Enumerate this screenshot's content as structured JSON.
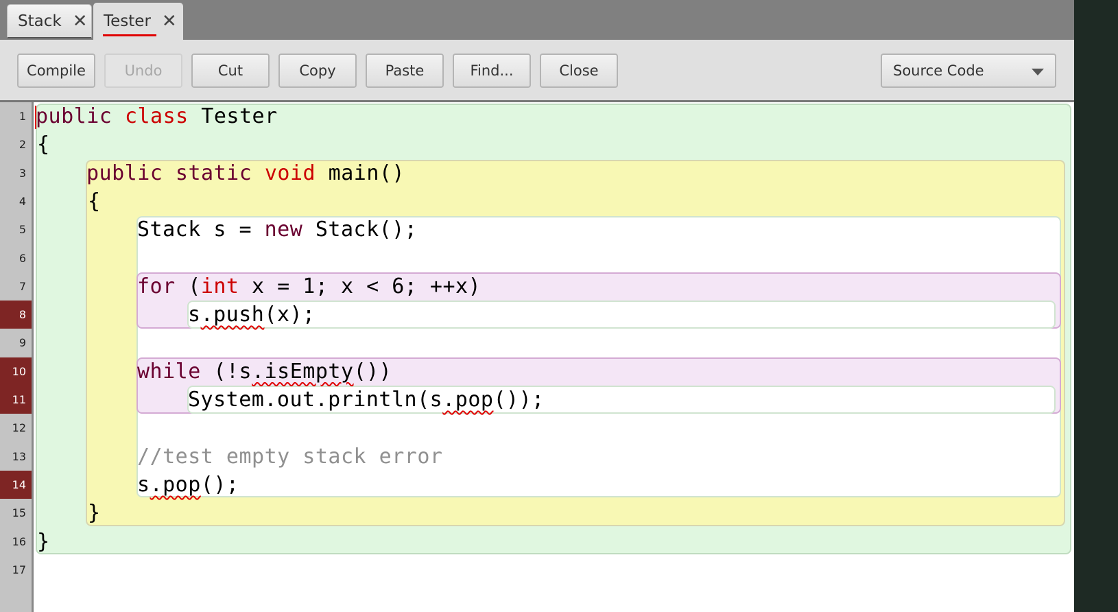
{
  "tabs": [
    {
      "label": "Stack",
      "active": false
    },
    {
      "label": "Tester",
      "active": true
    }
  ],
  "toolbar": {
    "compile": "Compile",
    "undo": "Undo",
    "cut": "Cut",
    "copy": "Copy",
    "paste": "Paste",
    "find": "Find...",
    "close": "Close",
    "view_select": "Source Code"
  },
  "colors": {
    "error_line": "#7e2524",
    "keyword": "#6a0030",
    "type_keyword": "#cc0000",
    "comment": "#909090",
    "class_scope": "#e0f7e0",
    "method_scope": "#f8f8b4",
    "loop_scope": "#f4e6f6"
  },
  "editor": {
    "line_numbers": [
      "1",
      "2",
      "3",
      "4",
      "5",
      "6",
      "7",
      "8",
      "9",
      "10",
      "11",
      "12",
      "13",
      "14",
      "15",
      "16",
      "17"
    ],
    "error_lines": [
      8,
      10,
      11,
      14
    ],
    "lines": {
      "l1": {
        "a": "public",
        "b": " ",
        "c": "class",
        "d": " Tester"
      },
      "l2": "{",
      "l3": {
        "a": "public static ",
        "b": "void",
        "c": " main()"
      },
      "l4": "{",
      "l5": {
        "a": "Stack s = ",
        "b": "new",
        "c": " Stack();"
      },
      "l7": {
        "a": "for",
        "b": " (",
        "c": "int",
        "d": " x = 1; x < 6; ++x)"
      },
      "l8": {
        "a": "s",
        "b": ".push",
        "c": "(x);"
      },
      "l10": {
        "a": "while",
        "b": " (!s",
        "c": ".isEmpty",
        "d": "())"
      },
      "l11": {
        "a": "System.out.println(s",
        "b": ".pop",
        "c": "());"
      },
      "l13": "//test empty stack error",
      "l14": {
        "a": "s",
        "b": ".pop",
        "c": "();"
      },
      "l15": "}",
      "l16": "}"
    }
  }
}
